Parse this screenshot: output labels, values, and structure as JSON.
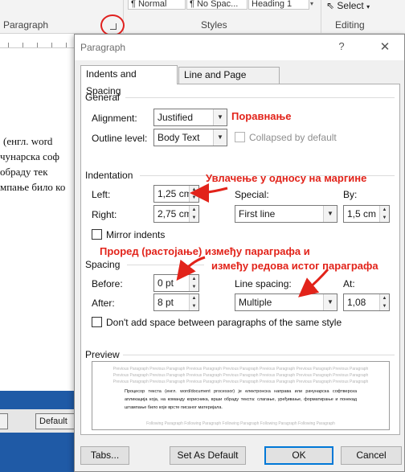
{
  "ribbon": {
    "styles": [
      "Normal",
      "No Spac...",
      "Heading 1"
    ],
    "select_label": "Select",
    "groups": {
      "paragraph": "Paragraph",
      "styles": "Styles",
      "editing": "Editing"
    }
  },
  "document": {
    "lines": [
      "(енгл.  word",
      "чунарска  соф",
      "  обраду  тек",
      "мпање било ко"
    ],
    "bottom_button": "Default"
  },
  "dialog": {
    "title": "Paragraph",
    "help_label": "?",
    "close_label": "✕",
    "tabs": [
      {
        "label": "Indents and Spacing",
        "active": true
      },
      {
        "label": "Line and Page Breaks",
        "active": false
      }
    ],
    "general": {
      "heading": "General",
      "alignment_label": "Alignment:",
      "alignment_value": "Justified",
      "outline_label": "Outline level:",
      "outline_value": "Body Text",
      "collapsed_label": "Collapsed by default"
    },
    "indentation": {
      "heading": "Indentation",
      "left_label": "Left:",
      "left_value": "1,25 cm",
      "right_label": "Right:",
      "right_value": "2,75 cm",
      "special_label": "Special:",
      "special_value": "First line",
      "by_label": "By:",
      "by_value": "1,5 cm",
      "mirror_label": "Mirror indents"
    },
    "spacing": {
      "heading": "Spacing",
      "before_label": "Before:",
      "before_value": "0 pt",
      "after_label": "After:",
      "after_value": "8 pt",
      "line_spacing_label": "Line spacing:",
      "line_spacing_value": "Multiple",
      "at_label": "At:",
      "at_value": "1,08",
      "dont_add_label": "Don't add space between paragraphs of the same style"
    },
    "preview": {
      "heading": "Preview",
      "previous_text": "Previous Paragraph Previous Paragraph Previous Paragraph Previous Paragraph Previous Paragraph Previous Paragraph Previous Paragraph",
      "body_text": "Процесор текста (енгл. word/document processor) је електронска направа или рачунарска софтверска апликација која, на команду корисника, врши обраду текста: слагање, уређивање, форматирање и понекад штампање било које врсте писаног материјала.",
      "following_text": "Following Paragraph Following Paragraph Following Paragraph Following Paragraph Following Paragraph"
    },
    "buttons": {
      "tabs": "Tabs...",
      "set_default": "Set As Default",
      "ok": "OK",
      "cancel": "Cancel"
    }
  },
  "annotations": {
    "alignment": "Поравнање",
    "indentation": "Увлачење у односу на маргине",
    "spacing_line1": "Проред (растојање) између параграфа и",
    "spacing_line2": "између редова истог параграфа"
  },
  "colors": {
    "annotation": "#e2231a",
    "ok_border": "#0078d7",
    "doc_bar": "#1f5aa6"
  }
}
